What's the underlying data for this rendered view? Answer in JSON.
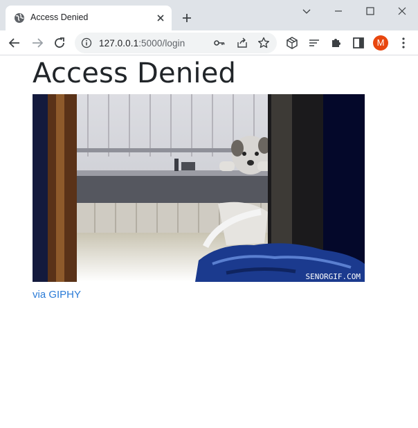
{
  "browser": {
    "tab_title": "Access Denied",
    "url_host": "127.0.0.1",
    "url_rest": ":5000/login",
    "profile_initial": "M"
  },
  "page": {
    "heading": "Access Denied",
    "gif": {
      "watermark": "SENORGIF.COM",
      "alt": "dog looking over fence gif"
    },
    "link_text": "via GIPHY"
  },
  "colors": {
    "link": "#2a7bd7",
    "avatar": "#e8470f",
    "heading": "#212529"
  }
}
